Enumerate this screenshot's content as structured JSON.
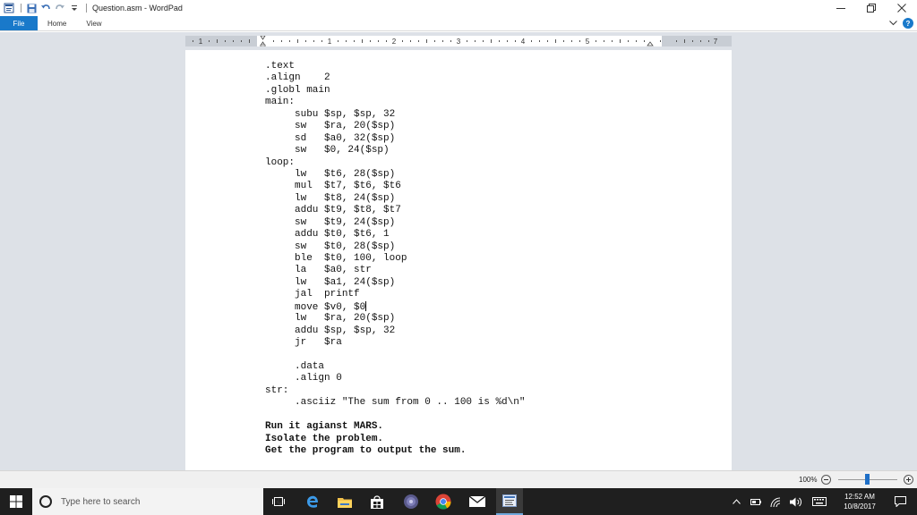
{
  "window": {
    "title": "Question.asm - WordPad"
  },
  "ribbon": {
    "tabs": [
      {
        "label": "File"
      },
      {
        "label": "Home"
      },
      {
        "label": "View"
      }
    ]
  },
  "ruler": {
    "numbers": [
      "1",
      "1",
      "2",
      "3",
      "4",
      "5",
      "7"
    ]
  },
  "document": {
    "lines": [
      {
        "text": ".text"
      },
      {
        "text": ".align    2"
      },
      {
        "text": ".globl main"
      },
      {
        "text": "main:"
      },
      {
        "text": "     subu $sp, $sp, 32"
      },
      {
        "text": "     sw   $ra, 20($sp)"
      },
      {
        "text": "     sd   $a0, 32($sp)"
      },
      {
        "text": "     sw   $0, 24($sp)"
      },
      {
        "text": "loop:"
      },
      {
        "text": "     lw   $t6, 28($sp)"
      },
      {
        "text": "     mul  $t7, $t6, $t6"
      },
      {
        "text": "     lw   $t8, 24($sp)"
      },
      {
        "text": "     addu $t9, $t8, $t7"
      },
      {
        "text": "     sw   $t9, 24($sp)"
      },
      {
        "text": "     addu $t0, $t6, 1"
      },
      {
        "text": "     sw   $t0, 28($sp)"
      },
      {
        "text": "     ble  $t0, 100, loop"
      },
      {
        "text": "     la   $a0, str"
      },
      {
        "text": "     lw   $a1, 24($sp)"
      },
      {
        "text": "     jal  printf"
      },
      {
        "text": "     move $v0, $0"
      },
      {
        "text": "     lw   $ra, 20($sp)"
      },
      {
        "text": "     addu $sp, $sp, 32"
      },
      {
        "text": "     jr   $ra"
      },
      {
        "text": ""
      },
      {
        "text": "     .data"
      },
      {
        "text": "     .align 0"
      },
      {
        "text": "str:"
      },
      {
        "text": "     .asciiz \"The sum from 0 .. 100 is %d\\n\""
      },
      {
        "text": ""
      },
      {
        "text": "Run it agianst MARS.",
        "bold": true
      },
      {
        "text": "Isolate the problem.",
        "bold": true
      },
      {
        "text": "Get the program to output the sum.",
        "bold": true
      }
    ]
  },
  "statusbar": {
    "zoom": "100%"
  },
  "taskbar": {
    "search_placeholder": "Type here to search",
    "time": "12:52 AM",
    "date": "10/8/2017"
  },
  "colors": {
    "accent": "#1979ca",
    "taskbar": "#1f1f1f",
    "canvas": "#dde1e7"
  },
  "icons": {
    "app": "wordpad-icon",
    "save": "save-icon",
    "undo": "undo-icon",
    "redo": "redo-icon",
    "help": "help-icon"
  }
}
